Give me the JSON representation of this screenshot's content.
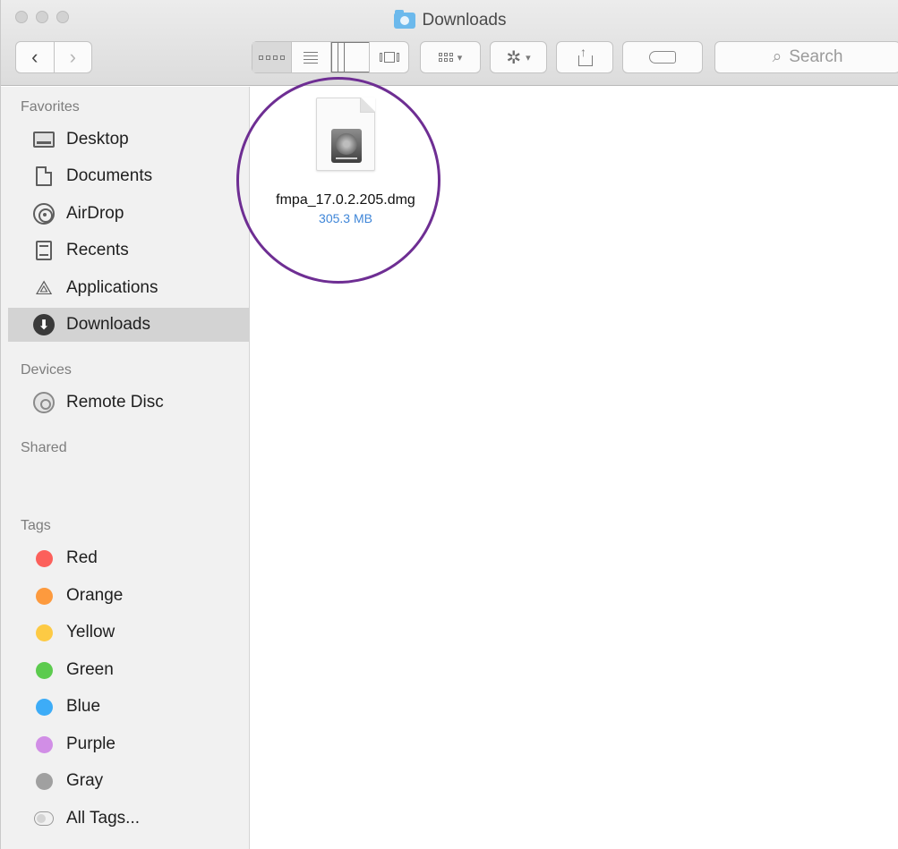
{
  "window": {
    "title": "Downloads"
  },
  "toolbar": {
    "back_label": "‹",
    "forward_label": "›",
    "search_placeholder": "Search",
    "action_glyph": "✲"
  },
  "sidebar": {
    "favorites_title": "Favorites",
    "favorites": [
      {
        "label": "Desktop",
        "icon": "desktop-icon"
      },
      {
        "label": "Documents",
        "icon": "documents-icon"
      },
      {
        "label": "AirDrop",
        "icon": "airdrop-icon"
      },
      {
        "label": "Recents",
        "icon": "recents-icon"
      },
      {
        "label": "Applications",
        "icon": "applications-icon",
        "glyph": "⟁"
      },
      {
        "label": "Downloads",
        "icon": "downloads-icon",
        "glyph": "⬇",
        "selected": true
      }
    ],
    "devices_title": "Devices",
    "devices": [
      {
        "label": "Remote Disc",
        "icon": "remote-disc-icon"
      }
    ],
    "shared_title": "Shared",
    "tags_title": "Tags",
    "tags": [
      {
        "label": "Red",
        "color": "#fc605b"
      },
      {
        "label": "Orange",
        "color": "#fd9a3e"
      },
      {
        "label": "Yellow",
        "color": "#fdca44"
      },
      {
        "label": "Green",
        "color": "#5ccb4e"
      },
      {
        "label": "Blue",
        "color": "#3dacf7"
      },
      {
        "label": "Purple",
        "color": "#d18ee6"
      },
      {
        "label": "Gray",
        "color": "#a0a0a0"
      },
      {
        "label": "All Tags...",
        "color": ""
      }
    ]
  },
  "content": {
    "files": [
      {
        "name": "fmpa_17.0.2.205.dmg",
        "size": "305.3 MB",
        "icon": "disk-image-icon"
      }
    ],
    "highlight_color": "#6e2e93"
  }
}
